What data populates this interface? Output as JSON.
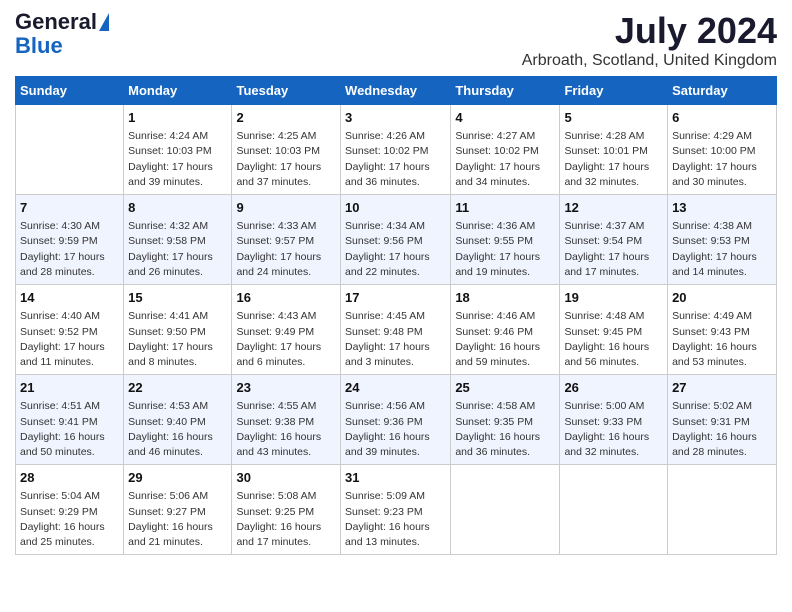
{
  "header": {
    "logo_general": "General",
    "logo_blue": "Blue",
    "main_title": "July 2024",
    "subtitle": "Arbroath, Scotland, United Kingdom"
  },
  "calendar": {
    "days_of_week": [
      "Sunday",
      "Monday",
      "Tuesday",
      "Wednesday",
      "Thursday",
      "Friday",
      "Saturday"
    ],
    "weeks": [
      [
        {
          "day": "",
          "content": ""
        },
        {
          "day": "1",
          "content": "Sunrise: 4:24 AM\nSunset: 10:03 PM\nDaylight: 17 hours\nand 39 minutes."
        },
        {
          "day": "2",
          "content": "Sunrise: 4:25 AM\nSunset: 10:03 PM\nDaylight: 17 hours\nand 37 minutes."
        },
        {
          "day": "3",
          "content": "Sunrise: 4:26 AM\nSunset: 10:02 PM\nDaylight: 17 hours\nand 36 minutes."
        },
        {
          "day": "4",
          "content": "Sunrise: 4:27 AM\nSunset: 10:02 PM\nDaylight: 17 hours\nand 34 minutes."
        },
        {
          "day": "5",
          "content": "Sunrise: 4:28 AM\nSunset: 10:01 PM\nDaylight: 17 hours\nand 32 minutes."
        },
        {
          "day": "6",
          "content": "Sunrise: 4:29 AM\nSunset: 10:00 PM\nDaylight: 17 hours\nand 30 minutes."
        }
      ],
      [
        {
          "day": "7",
          "content": "Sunrise: 4:30 AM\nSunset: 9:59 PM\nDaylight: 17 hours\nand 28 minutes."
        },
        {
          "day": "8",
          "content": "Sunrise: 4:32 AM\nSunset: 9:58 PM\nDaylight: 17 hours\nand 26 minutes."
        },
        {
          "day": "9",
          "content": "Sunrise: 4:33 AM\nSunset: 9:57 PM\nDaylight: 17 hours\nand 24 minutes."
        },
        {
          "day": "10",
          "content": "Sunrise: 4:34 AM\nSunset: 9:56 PM\nDaylight: 17 hours\nand 22 minutes."
        },
        {
          "day": "11",
          "content": "Sunrise: 4:36 AM\nSunset: 9:55 PM\nDaylight: 17 hours\nand 19 minutes."
        },
        {
          "day": "12",
          "content": "Sunrise: 4:37 AM\nSunset: 9:54 PM\nDaylight: 17 hours\nand 17 minutes."
        },
        {
          "day": "13",
          "content": "Sunrise: 4:38 AM\nSunset: 9:53 PM\nDaylight: 17 hours\nand 14 minutes."
        }
      ],
      [
        {
          "day": "14",
          "content": "Sunrise: 4:40 AM\nSunset: 9:52 PM\nDaylight: 17 hours\nand 11 minutes."
        },
        {
          "day": "15",
          "content": "Sunrise: 4:41 AM\nSunset: 9:50 PM\nDaylight: 17 hours\nand 8 minutes."
        },
        {
          "day": "16",
          "content": "Sunrise: 4:43 AM\nSunset: 9:49 PM\nDaylight: 17 hours\nand 6 minutes."
        },
        {
          "day": "17",
          "content": "Sunrise: 4:45 AM\nSunset: 9:48 PM\nDaylight: 17 hours\nand 3 minutes."
        },
        {
          "day": "18",
          "content": "Sunrise: 4:46 AM\nSunset: 9:46 PM\nDaylight: 16 hours\nand 59 minutes."
        },
        {
          "day": "19",
          "content": "Sunrise: 4:48 AM\nSunset: 9:45 PM\nDaylight: 16 hours\nand 56 minutes."
        },
        {
          "day": "20",
          "content": "Sunrise: 4:49 AM\nSunset: 9:43 PM\nDaylight: 16 hours\nand 53 minutes."
        }
      ],
      [
        {
          "day": "21",
          "content": "Sunrise: 4:51 AM\nSunset: 9:41 PM\nDaylight: 16 hours\nand 50 minutes."
        },
        {
          "day": "22",
          "content": "Sunrise: 4:53 AM\nSunset: 9:40 PM\nDaylight: 16 hours\nand 46 minutes."
        },
        {
          "day": "23",
          "content": "Sunrise: 4:55 AM\nSunset: 9:38 PM\nDaylight: 16 hours\nand 43 minutes."
        },
        {
          "day": "24",
          "content": "Sunrise: 4:56 AM\nSunset: 9:36 PM\nDaylight: 16 hours\nand 39 minutes."
        },
        {
          "day": "25",
          "content": "Sunrise: 4:58 AM\nSunset: 9:35 PM\nDaylight: 16 hours\nand 36 minutes."
        },
        {
          "day": "26",
          "content": "Sunrise: 5:00 AM\nSunset: 9:33 PM\nDaylight: 16 hours\nand 32 minutes."
        },
        {
          "day": "27",
          "content": "Sunrise: 5:02 AM\nSunset: 9:31 PM\nDaylight: 16 hours\nand 28 minutes."
        }
      ],
      [
        {
          "day": "28",
          "content": "Sunrise: 5:04 AM\nSunset: 9:29 PM\nDaylight: 16 hours\nand 25 minutes."
        },
        {
          "day": "29",
          "content": "Sunrise: 5:06 AM\nSunset: 9:27 PM\nDaylight: 16 hours\nand 21 minutes."
        },
        {
          "day": "30",
          "content": "Sunrise: 5:08 AM\nSunset: 9:25 PM\nDaylight: 16 hours\nand 17 minutes."
        },
        {
          "day": "31",
          "content": "Sunrise: 5:09 AM\nSunset: 9:23 PM\nDaylight: 16 hours\nand 13 minutes."
        },
        {
          "day": "",
          "content": ""
        },
        {
          "day": "",
          "content": ""
        },
        {
          "day": "",
          "content": ""
        }
      ]
    ]
  }
}
